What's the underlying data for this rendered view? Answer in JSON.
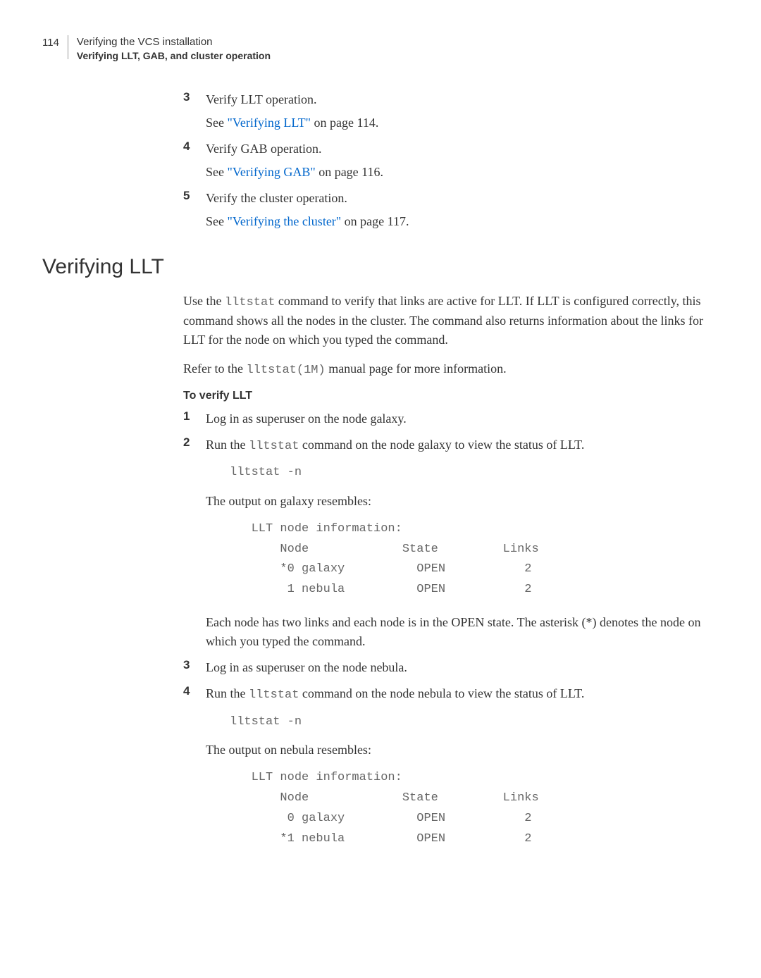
{
  "header": {
    "page_number": "114",
    "chapter": "Verifying the VCS installation",
    "section": "Verifying LLT, GAB, and cluster operation"
  },
  "top_steps": [
    {
      "num": "3",
      "text": "Verify LLT operation.",
      "see_prefix": "See ",
      "link": "\"Verifying LLT\"",
      "see_suffix": " on page 114."
    },
    {
      "num": "4",
      "text": "Verify GAB operation.",
      "see_prefix": "See ",
      "link": "\"Verifying GAB\"",
      "see_suffix": " on page 116."
    },
    {
      "num": "5",
      "text": "Verify the cluster operation.",
      "see_prefix": "See ",
      "link": "\"Verifying the cluster\"",
      "see_suffix": " on page 117."
    }
  ],
  "heading": "Verifying LLT",
  "intro": {
    "p1_a": "Use the ",
    "p1_code": "lltstat",
    "p1_b": " command to verify that links are active for LLT. If LLT is configured correctly, this command shows all the nodes in the cluster. The command also returns information about the links for LLT for the node on which you typed the command.",
    "p2_a": "Refer to the ",
    "p2_code": "lltstat(1M)",
    "p2_b": " manual page for more information."
  },
  "subheading": "To verify LLT",
  "steps": [
    {
      "num": "1",
      "text": "Log in as superuser on the node galaxy."
    },
    {
      "num": "2",
      "text_a": "Run the ",
      "code": "lltstat",
      "text_b": " command on the node galaxy to view the status of LLT.",
      "cmd": "lltstat -n",
      "out_intro": "The output on galaxy resembles:",
      "output": "   LLT node information:\n       Node             State         Links\n       *0 galaxy          OPEN           2\n        1 nebula          OPEN           2",
      "after": "Each node has two links and each node is in the OPEN state. The asterisk (*) denotes the node on which you typed the command."
    },
    {
      "num": "3",
      "text": "Log in as superuser on the node nebula."
    },
    {
      "num": "4",
      "text_a": "Run the ",
      "code": "lltstat",
      "text_b": " command on the node nebula to view the status of LLT.",
      "cmd": "lltstat -n",
      "out_intro": "The output on nebula resembles:",
      "output": "   LLT node information:\n       Node             State         Links\n        0 galaxy          OPEN           2\n       *1 nebula          OPEN           2"
    }
  ]
}
